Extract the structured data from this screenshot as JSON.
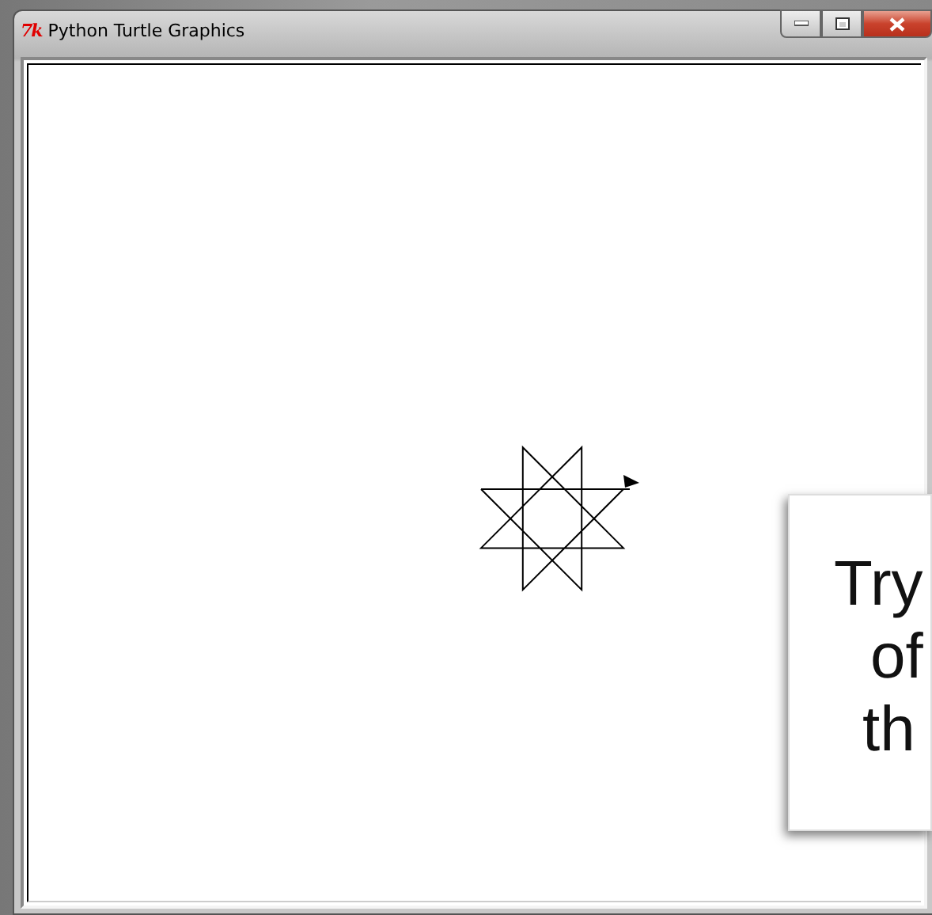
{
  "window": {
    "title": "Python Turtle Graphics",
    "app_icon": "7k"
  },
  "overlay_card": {
    "lines": [
      "Try",
      "of",
      "th"
    ]
  }
}
